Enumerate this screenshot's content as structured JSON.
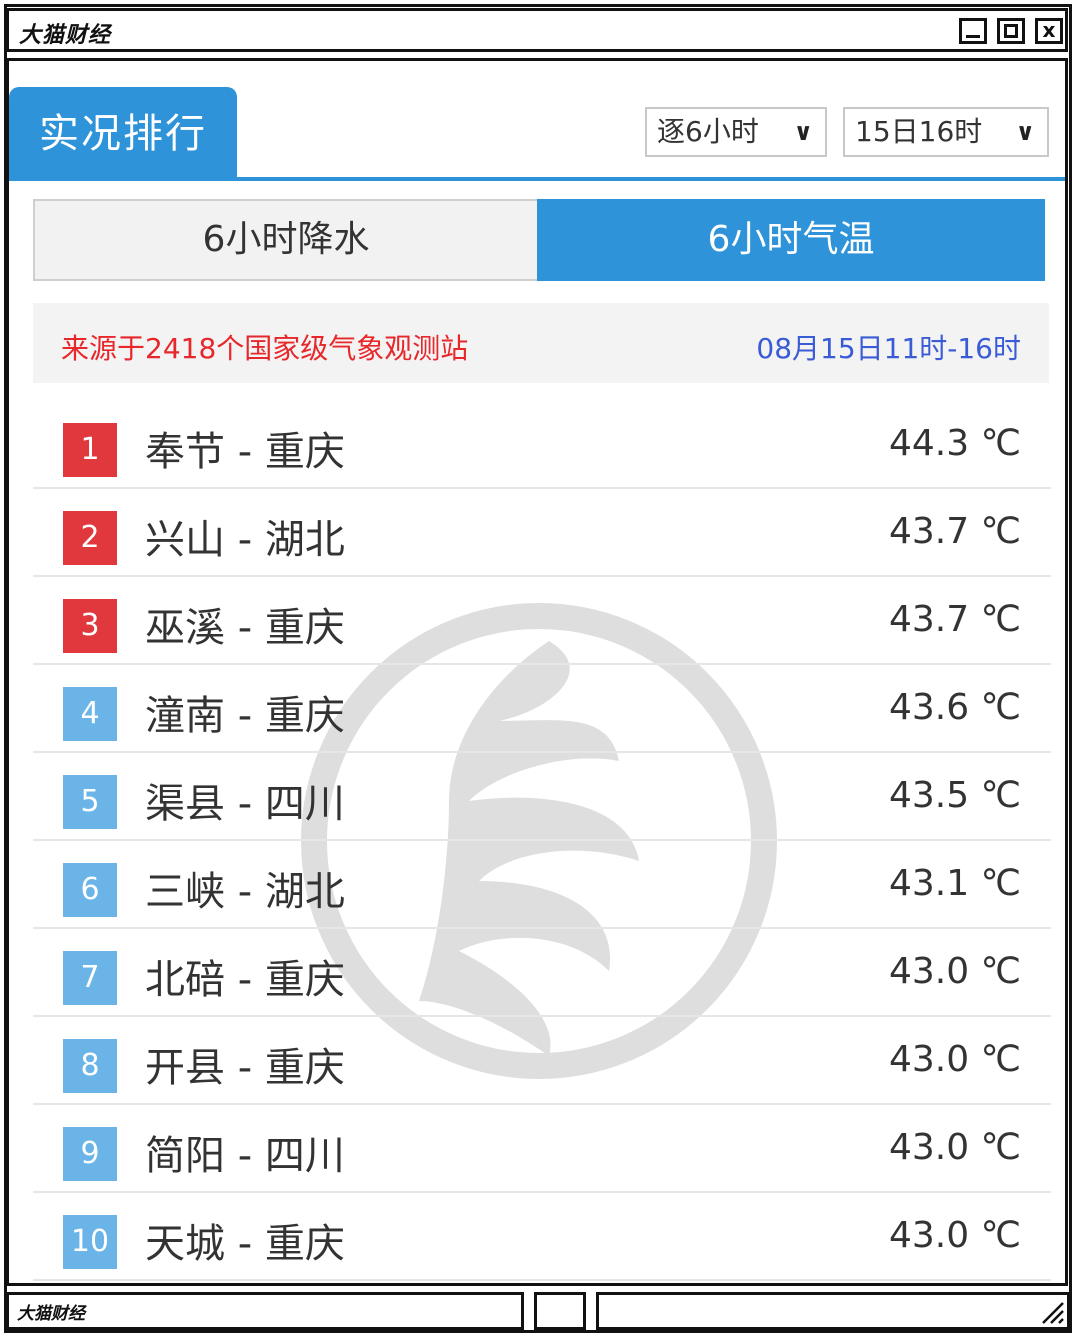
{
  "window": {
    "title": "大猫财经",
    "status_text": "大猫财经"
  },
  "header": {
    "tab_label": "实况排行",
    "select_interval": "逐6小时",
    "select_time": "15日16时"
  },
  "toggle": {
    "left_label": "6小时降水",
    "right_label": "6小时气温",
    "active": "right"
  },
  "info": {
    "source": "来源于2418个国家级气象观测站",
    "period": "08月15日11时-16时"
  },
  "ranking": [
    {
      "rank": "1",
      "station": "奉节 - 重庆",
      "temp": "44.3 ℃",
      "badge": "red"
    },
    {
      "rank": "2",
      "station": "兴山 - 湖北",
      "temp": "43.7 ℃",
      "badge": "red"
    },
    {
      "rank": "3",
      "station": "巫溪 - 重庆",
      "temp": "43.7 ℃",
      "badge": "red"
    },
    {
      "rank": "4",
      "station": "潼南 - 重庆",
      "temp": "43.6 ℃",
      "badge": "blue"
    },
    {
      "rank": "5",
      "station": "渠县 - 四川",
      "temp": "43.5 ℃",
      "badge": "blue"
    },
    {
      "rank": "6",
      "station": "三峡 - 湖北",
      "temp": "43.1 ℃",
      "badge": "blue"
    },
    {
      "rank": "7",
      "station": "北碚 - 重庆",
      "temp": "43.0 ℃",
      "badge": "blue"
    },
    {
      "rank": "8",
      "station": "开县 - 重庆",
      "temp": "43.0 ℃",
      "badge": "blue"
    },
    {
      "rank": "9",
      "station": "简阳 - 四川",
      "temp": "43.0 ℃",
      "badge": "blue"
    },
    {
      "rank": "10",
      "station": "天城 - 重庆",
      "temp": "43.0 ℃",
      "badge": "blue"
    }
  ],
  "colors": {
    "accent_blue": "#2e93d8",
    "badge_red": "#e0383c",
    "badge_blue": "#6bb4e8",
    "source_text": "#e8272b",
    "period_text": "#3a5bd6"
  },
  "icons": {
    "minimize": "minimize-icon",
    "maximize": "maximize-icon",
    "close": "close-icon",
    "dropdown": "chevron-down-icon",
    "watermark": "cma-logo-watermark",
    "resize": "resize-grip-icon"
  }
}
